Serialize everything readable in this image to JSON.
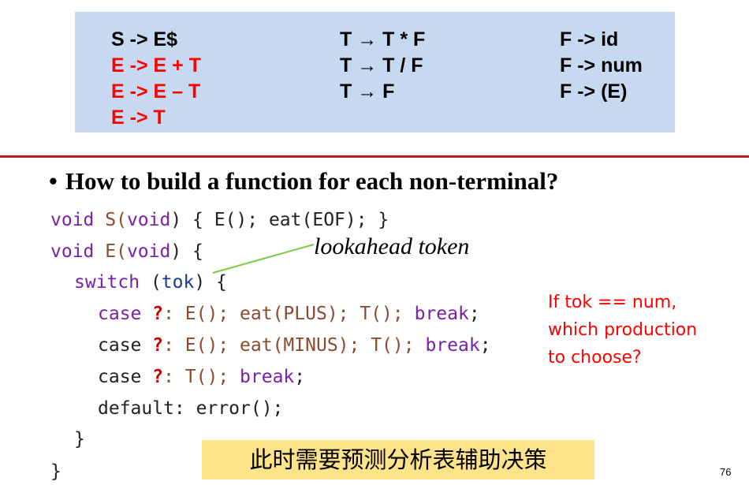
{
  "grammar": {
    "col1": [
      {
        "text": "S -> E$",
        "color": "#000000"
      },
      {
        "text": "E -> E + T",
        "color": "#ff0000"
      },
      {
        "text": "E -> E – T",
        "color": "#ff0000"
      },
      {
        "text": "E -> T",
        "color": "#ff0000"
      }
    ],
    "col2": [
      "T → T * F",
      "T → T / F",
      "T → F"
    ],
    "col3": [
      "F -> id",
      "F -> num",
      "F -> (E)"
    ]
  },
  "heading": {
    "bullet": "•",
    "text": "How to build a function for each non-terminal?"
  },
  "code": {
    "l1": {
      "a": "void",
      "b": " S(",
      "c": "void",
      "d": ") { E(); eat(EOF); }"
    },
    "l2": {
      "a": "void",
      "b": " E(",
      "c": "void",
      "d": ") {"
    },
    "l3": {
      "a": "switch",
      "b": " (",
      "c": "tok",
      "d": ") {"
    },
    "l4": {
      "a": "case",
      "b": " ",
      "q": "?",
      "c": ": E(); eat(PLUS); T(); ",
      "d": "break",
      "e": ";"
    },
    "l5": {
      "a": "case",
      "b": " ",
      "q": "?",
      "c": ": E(); eat(MINUS); T(); ",
      "d": "break",
      "e": ";"
    },
    "l6": {
      "a": "case",
      "b": " ",
      "q": "?",
      "c": ": T(); ",
      "d": "break",
      "e": ";"
    },
    "l7": {
      "a": "default: error();"
    },
    "l8": {
      "a": "}"
    },
    "l9": {
      "a": "}"
    }
  },
  "annotation": {
    "lookahead": "lookahead token"
  },
  "callout": {
    "line1": "If tok == num,",
    "line2": "which production",
    "line3": "to choose?"
  },
  "note": {
    "text": "此时需要预测分析表辅助决策"
  },
  "page_number": "76",
  "colors": {
    "grammar_bg": "#c6d9f1",
    "divider": "#b01e1e",
    "highlight": "#ff0000",
    "note_bg": "#fde38a",
    "pointer_line": "#7ac943"
  }
}
